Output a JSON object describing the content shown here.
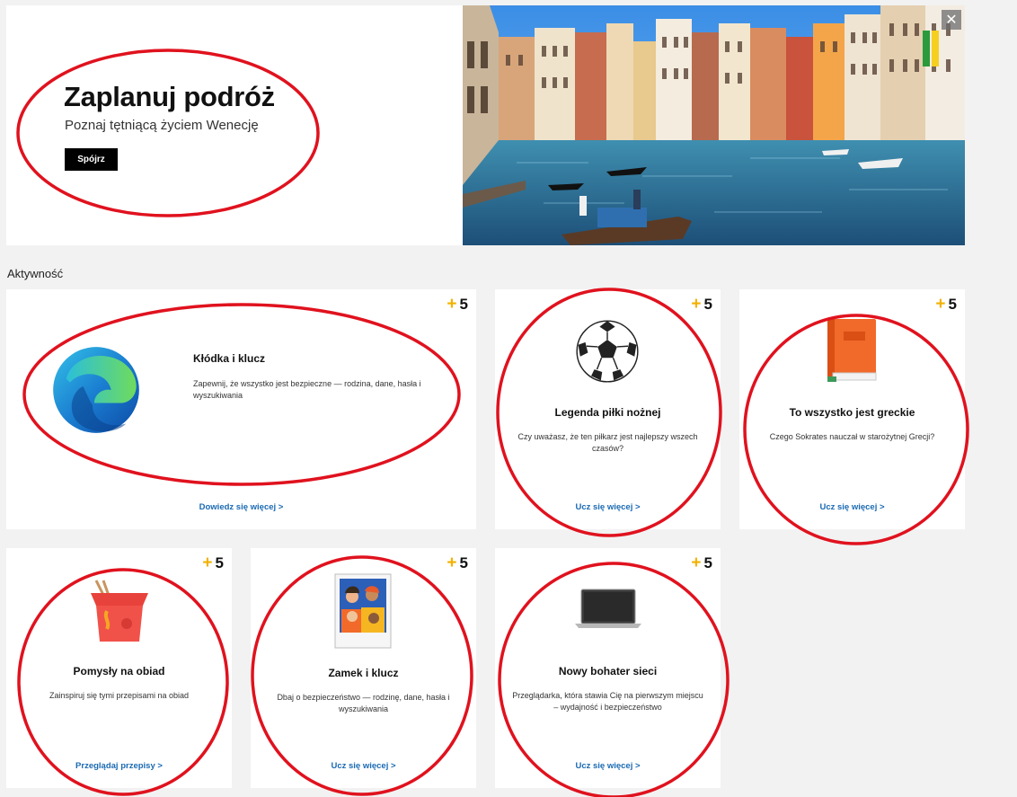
{
  "hero": {
    "title": "Zaplanuj podróż",
    "subtitle": "Poznaj tętniącą życiem Wenecję",
    "button": "Spójrz",
    "close": "✕"
  },
  "section_label": "Aktywność",
  "cards": [
    {
      "points_plus": "+",
      "points": "5",
      "title": "Kłódka i klucz",
      "desc": "Zapewnij, że wszystko jest bezpieczne — rodzina, dane, hasła i wyszukiwania",
      "link": "Dowiedz się więcej >",
      "icon": "edge-logo-icon"
    },
    {
      "points_plus": "+",
      "points": "5",
      "title": "Legenda piłki nożnej",
      "desc": "Czy uważasz, że ten piłkarz jest najlepszy wszech czasów?",
      "link": "Ucz się więcej >",
      "icon": "soccer-ball-icon"
    },
    {
      "points_plus": "+",
      "points": "5",
      "title": "To wszystko jest greckie",
      "desc": "Czego Sokrates nauczał w starożytnej Grecji?",
      "link": "Ucz się więcej >",
      "icon": "book-icon"
    },
    {
      "points_plus": "+",
      "points": "5",
      "title": "Pomysły na obiad",
      "desc": "Zainspiruj się tymi przepisami na obiad",
      "link": "Przeglądaj przepisy >",
      "icon": "takeout-box-icon"
    },
    {
      "points_plus": "+",
      "points": "5",
      "title": "Zamek i klucz",
      "desc": "Dbaj o bezpieczeństwo — rodzinę, dane, hasła i wyszukiwania",
      "link": "Ucz się więcej >",
      "icon": "family-photo-icon"
    },
    {
      "points_plus": "+",
      "points": "5",
      "title": "Nowy bohater sieci",
      "desc": "Przeglądarka, która stawia Cię na pierwszym miejscu – wydajność i bezpieczeństwo",
      "link": "Ucz się więcej >",
      "icon": "laptop-icon"
    }
  ],
  "colors": {
    "accent_link": "#1a6ab3",
    "points_plus": "#f2b100",
    "annotation_ring": "#e0121e"
  }
}
